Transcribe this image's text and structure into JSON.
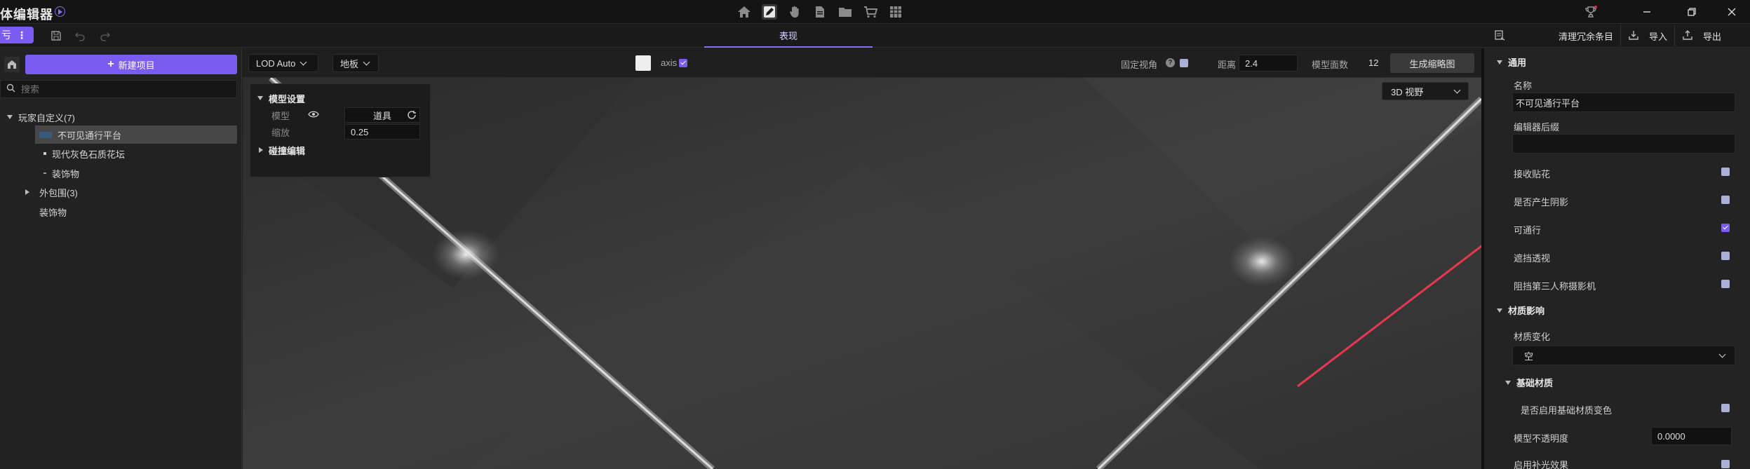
{
  "topbar": {
    "title": "体编辑器",
    "center_icons": [
      "home-icon",
      "edit-icon",
      "hand-icon",
      "document-icon",
      "folder-icon",
      "cart-icon",
      "grid-icon"
    ],
    "right_icons": [
      "trophy-icon",
      "minimize-icon",
      "restore-icon",
      "close-icon"
    ]
  },
  "subbar": {
    "mode_label": "亏",
    "tab_label": "表现",
    "actions": {
      "clean_label": "清理冗余条目",
      "import_label": "导入",
      "export_label": "导出"
    }
  },
  "left_panel": {
    "new_button_label": "新建项目",
    "search_placeholder": "搜索",
    "tree": [
      {
        "label": "玩家自定义(7)"
      },
      {
        "label": "不可见通行平台"
      },
      {
        "label": "现代灰色石质花坛"
      },
      {
        "label": "装饰物"
      },
      {
        "label": "外包围(3)"
      },
      {
        "label": "装饰物"
      }
    ]
  },
  "viewport_toolbar": {
    "lod_label": "LOD Auto",
    "floor_label": "地板",
    "axis_label": "axis",
    "fixed_view_label": "固定视角",
    "distance_label": "距离",
    "distance_value": "2.4",
    "faces_label": "模型面数",
    "faces_value": "12",
    "generate_thumb_label": "生成缩略图"
  },
  "model_settings": {
    "section_label": "模型设置",
    "model_label": "模型",
    "model_value": "道具",
    "scale_label": "缩放",
    "scale_value": "0.25",
    "collision_label": "碰撞编辑"
  },
  "view_mode": {
    "label": "3D 视野"
  },
  "right_panel": {
    "general_section": "通用",
    "name_label": "名称",
    "name_value": "不可见通行平台",
    "editor_suffix_label": "编辑器后缀",
    "editor_suffix_value": "",
    "options": [
      {
        "label": "接收贴花",
        "checked": false
      },
      {
        "label": "是否产生阴影",
        "checked": false
      },
      {
        "label": "可通行",
        "checked": true
      },
      {
        "label": "遮挡透视",
        "checked": false
      },
      {
        "label": "阻挡第三人称摄影机",
        "checked": false
      }
    ],
    "material_section": "材质影响",
    "material_change_label": "材质变化",
    "material_change_value": "空",
    "base_material_section": "基础材质",
    "base_material_toggle_label": "是否启用基础材质变色",
    "opacity_label": "模型不透明度",
    "opacity_value": "0.0000",
    "fill_light_label": "启用补光效果"
  },
  "colors": {
    "accent": "#7b5cf0",
    "annotation_arrow": "#e8384f"
  }
}
